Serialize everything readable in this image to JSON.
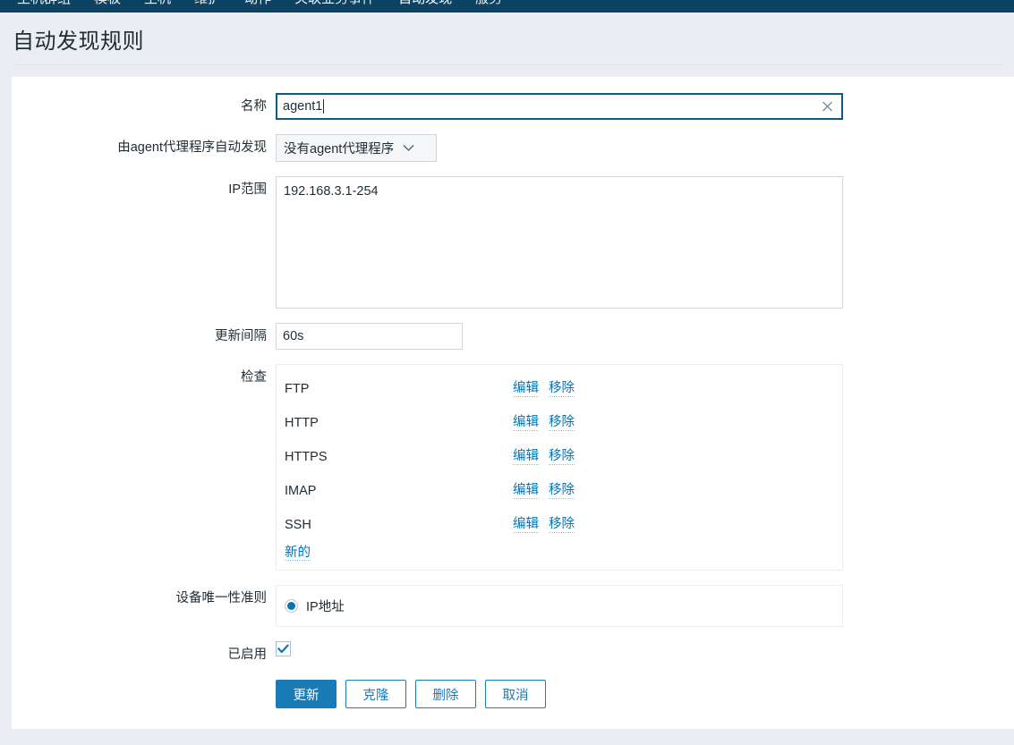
{
  "nav": {
    "items": [
      {
        "label": "主机群组",
        "active": false
      },
      {
        "label": "模板",
        "active": false
      },
      {
        "label": "主机",
        "active": false
      },
      {
        "label": "维护",
        "active": false
      },
      {
        "label": "动作",
        "active": false
      },
      {
        "label": "关联业务事件",
        "active": false
      },
      {
        "label": "自动发现",
        "active": true
      },
      {
        "label": "服务",
        "active": false
      }
    ]
  },
  "page": {
    "title": "自动发现规则"
  },
  "form": {
    "name": {
      "label": "名称",
      "value": "agent1"
    },
    "proxy": {
      "label": "由agent代理程序自动发现",
      "value": "没有agent代理程序",
      "options": [
        "没有agent代理程序"
      ]
    },
    "ip_range": {
      "label": "IP范围",
      "value": "192.168.3.1-254"
    },
    "interval": {
      "label": "更新间隔",
      "value": "60s"
    },
    "checks": {
      "label": "检查",
      "edit_label": "编辑",
      "remove_label": "移除",
      "new_label": "新的",
      "rows": [
        {
          "name": "FTP"
        },
        {
          "name": "HTTP"
        },
        {
          "name": "HTTPS"
        },
        {
          "name": "IMAP"
        },
        {
          "name": "SSH"
        }
      ]
    },
    "uniqueness": {
      "label": "设备唯一性准则",
      "selected": "IP地址",
      "options": [
        "IP地址"
      ]
    },
    "enabled": {
      "label": "已启用",
      "checked": true
    }
  },
  "buttons": {
    "update": "更新",
    "clone": "克隆",
    "delete": "删除",
    "cancel": "取消"
  },
  "colors": {
    "nav_bg": "#0d4263",
    "accent": "#1a7bb9",
    "link": "#0275b8",
    "page_bg": "#eaeef2"
  }
}
